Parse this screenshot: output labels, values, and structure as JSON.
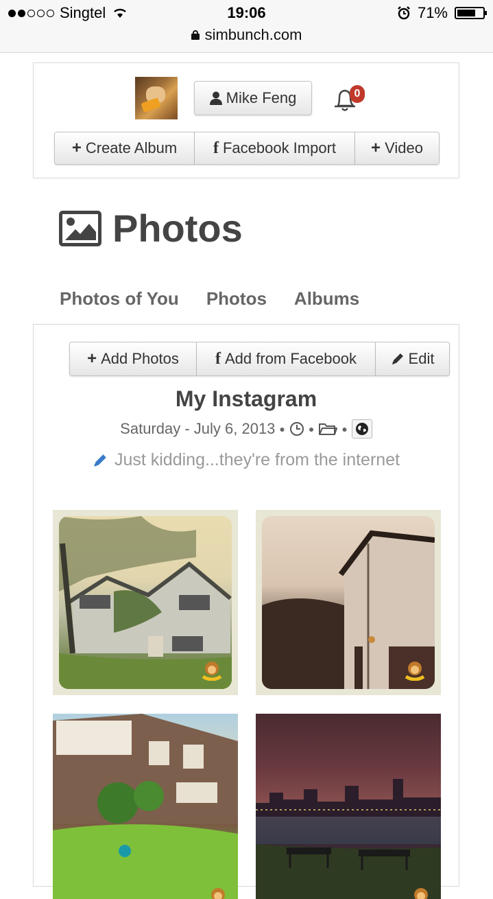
{
  "status_bar": {
    "carrier": "Singtel",
    "time": "19:06",
    "battery": "71%",
    "battery_level": 0.71,
    "url": "simbunch.com"
  },
  "header": {
    "user_name": "Mike Feng",
    "notification_count": "0",
    "actions": [
      "Create Album",
      "Facebook Import",
      "Video"
    ]
  },
  "page": {
    "title": "Photos",
    "tabs": [
      "Photos of You",
      "Photos",
      "Albums"
    ]
  },
  "album": {
    "actions": [
      "Add Photos",
      "Add from Facebook",
      "Edit"
    ],
    "title": "My Instagram",
    "date": "Saturday - July 6, 2013",
    "description": "Just kidding...they're from the internet"
  },
  "colors": {
    "badge": "#c0392b",
    "pencil": "#3a7bc8"
  },
  "icons": [
    "user-icon",
    "bell-icon",
    "picture-icon",
    "clock-icon",
    "folder-icon",
    "globe-icon",
    "pencil-icon",
    "monkey-watermark-icon"
  ]
}
